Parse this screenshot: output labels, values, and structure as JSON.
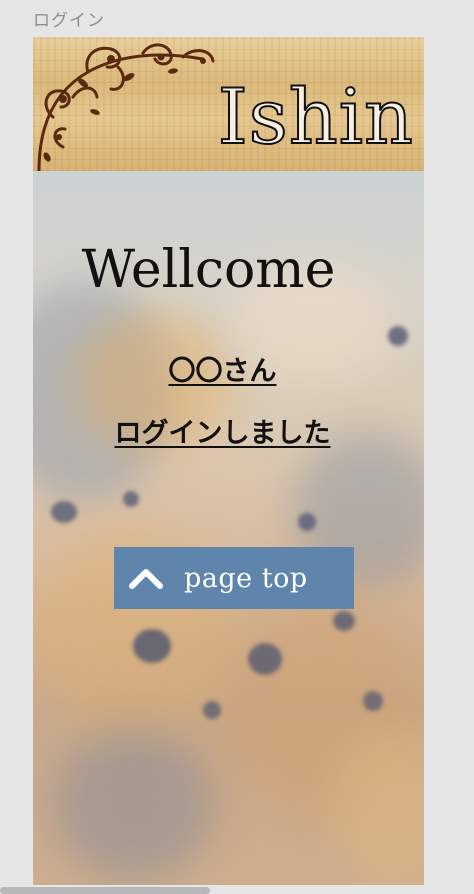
{
  "frame": {
    "title": "ログイン"
  },
  "header": {
    "logo_text": "Ishin"
  },
  "main": {
    "welcome": "Wellcome",
    "user_line": "〇〇さん",
    "status_line": "ログインしました",
    "page_top_label": "page top",
    "page_top_icon": "chevron-up-icon"
  },
  "colors": {
    "button_bg": "#5f85ad",
    "wood": "#dcb97c",
    "text": "#111111"
  }
}
